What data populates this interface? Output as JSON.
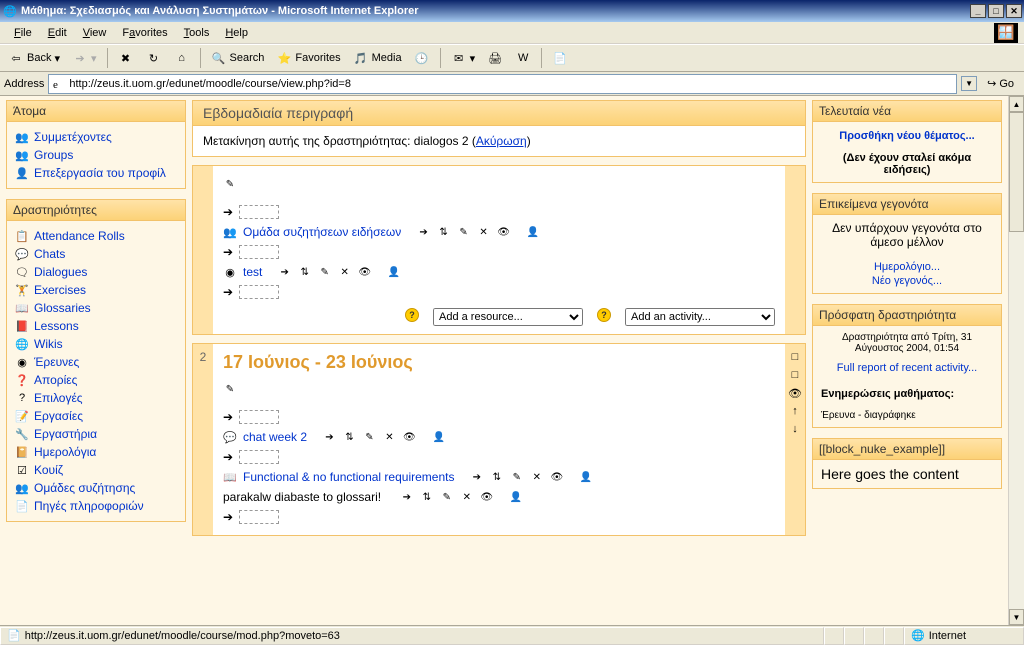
{
  "window": {
    "title": "Μάθημα: Σχεδιασμός και Ανάλυση Συστημάτων - Microsoft Internet Explorer"
  },
  "menubar": [
    "File",
    "Edit",
    "View",
    "Favorites",
    "Tools",
    "Help"
  ],
  "toolbar": {
    "back": "Back",
    "search": "Search",
    "favorites": "Favorites",
    "media": "Media"
  },
  "address": {
    "label": "Address",
    "url": "http://zeus.it.uom.gr/edunet/moodle/course/view.php?id=8",
    "go": "Go"
  },
  "left": {
    "people": {
      "title": "Άτομα",
      "items": [
        "Συμμετέχοντες",
        "Groups",
        "Επεξεργασία του προφίλ"
      ]
    },
    "activities": {
      "title": "Δραστηριότητες",
      "items": [
        "Attendance Rolls",
        "Chats",
        "Dialogues",
        "Exercises",
        "Glossaries",
        "Lessons",
        "Wikis",
        "Έρευνες",
        "Απορίες",
        "Επιλογές",
        "Εργασίες",
        "Εργαστήρια",
        "Ημερολόγια",
        "Κουίζ",
        "Ομάδες συζήτησης",
        "Πηγές πληροφοριών"
      ]
    }
  },
  "main": {
    "header": "Εβδομαδιαία περιγραφή",
    "notice_text": "Μετακίνηση αυτής της δραστηριότητας: dialogos 2  (",
    "notice_cancel": "Ακύρωση",
    "notice_close": ")",
    "sec0": {
      "forum": "Ομάδα συζητήσεων ειδήσεων",
      "test": "test",
      "add_resource": "Add a resource...",
      "add_activity": "Add an activity..."
    },
    "week2": {
      "num": "2",
      "title": "17 Ιούνιος - 23 Ιούνιος",
      "chat": "chat week 2",
      "functional": "Functional & no functional requirements",
      "glossary_note": "parakalw diabaste to glossari!"
    }
  },
  "right": {
    "news": {
      "title": "Τελευταία νέα",
      "add": "Προσθήκη νέου θέματος...",
      "none": "(Δεν έχουν σταλεί ακόμα ειδήσεις)"
    },
    "events": {
      "title": "Επικείμενα γεγονότα",
      "none": "Δεν υπάρχουν γεγονότα στο άμεσο μέλλον",
      "calendar": "Ημερολόγιο...",
      "new": "Νέο γεγονός..."
    },
    "recent": {
      "title": "Πρόσφατη δραστηριότητα",
      "since": "Δραστηριότητα από Τρίτη, 31 Αύγουστος 2004, 01:54",
      "full": "Full report of recent activity...",
      "updates": "Ενημερώσεις μαθήματος:",
      "deleted": "Έρευνα - διαγράφηκε"
    },
    "nuke": {
      "title": "[[block_nuke_example]]",
      "body": "Here goes the content"
    }
  },
  "statusbar": {
    "url": "http://zeus.it.uom.gr/edunet/moodle/course/mod.php?moveto=63",
    "zone": "Internet"
  }
}
